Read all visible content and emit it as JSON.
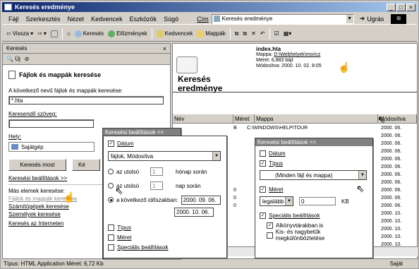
{
  "window": {
    "title": "Keresés eredménye",
    "controls": [
      "_",
      "□",
      "×"
    ]
  },
  "menubar": {
    "items": [
      "Fájl",
      "Szerkesztés",
      "Nézet",
      "Kedvencek",
      "Eszközök",
      "Súgó"
    ],
    "address_label": "Cím",
    "address_value": "Keresés eredménye",
    "go_label": "Ugrás"
  },
  "toolbar": {
    "back": "Vissza",
    "search": "Keresés",
    "history": "Előzmények",
    "favorites": "Kedvencek",
    "folders": "Mappák"
  },
  "left_pane": {
    "header": "Keresés",
    "new_label": "Új",
    "search_title": "Fájlok és mappák keresése",
    "name_label": "A következő nevű fájlok és mappák keresése:",
    "name_value": "*.hta",
    "text_label": "Keresendő szöveg:",
    "text_value": "",
    "place_label": "Hely:",
    "place_value": "Sajátgép",
    "search_now": "Keresés most",
    "stop_label": "Ké",
    "search_options_link": "Keresési beállítások >>",
    "other_label": "Más elemek keresése:",
    "links": [
      "Fájlok és mappák keresése",
      "Számítógépek keresése",
      "Személyek keresése",
      "Keresés az Interneten"
    ]
  },
  "banner": {
    "title": "Keresés eredménye",
    "file_name": "index.hta",
    "folder_label": "Mappa:",
    "folder_path": "D:\\Webhelyek\\moricz",
    "size_label": "Méret: 6,883 bájt",
    "modified_label": "Módosítva: 2000. 10. 02. 8:05"
  },
  "table": {
    "headers": [
      "Név",
      "Méret",
      "Mappa",
      "Módosítva"
    ],
    "rows": [
      {
        "name": "",
        "size": "B",
        "folder": "C:\\WINDOWS\\HELP\\TOUR",
        "modified": "2000. 06."
      },
      {
        "name": "",
        "size": "",
        "folder": "",
        "modified": "2000. 06."
      },
      {
        "name": "",
        "size": "",
        "folder": "",
        "modified": "2000. 06."
      },
      {
        "name": "",
        "size": "",
        "folder": "",
        "modified": "2000. 06."
      },
      {
        "name": "",
        "size": "",
        "folder": "",
        "modified": "2000. 06."
      },
      {
        "name": "",
        "size": "",
        "folder": "",
        "modified": "2000. 06."
      },
      {
        "name": "",
        "size": "",
        "folder": "",
        "modified": "2000. 06."
      },
      {
        "name": "",
        "size": "",
        "folder": "",
        "modified": "2000. 06."
      },
      {
        "name": "",
        "size": "0",
        "folder": "",
        "modified": "2000. 06."
      },
      {
        "name": "",
        "size": "0",
        "folder": "",
        "modified": "2000. 06."
      },
      {
        "name": "",
        "size": "0",
        "folder": "",
        "modified": "2000. 06."
      },
      {
        "name": "",
        "size": "",
        "folder": "",
        "modified": "2000. 10."
      },
      {
        "name": "",
        "size": "",
        "folder": "",
        "modified": "2000. 10."
      },
      {
        "name": "",
        "size": "",
        "folder": "",
        "modified": "2000. 10."
      },
      {
        "name": "",
        "size": "",
        "folder": "",
        "modified": "2000. 10."
      },
      {
        "name": "",
        "size": "",
        "folder": "",
        "modified": "2000. 10."
      }
    ]
  },
  "popup1": {
    "title": "Keresési beállítások <<",
    "date_label": "Dátum",
    "date_type": "fájlok, Módosítva",
    "last_label_1": "az utolsó",
    "last_value_1": "1",
    "last_unit_1": "hónap során",
    "last_label_2": "az utolsó",
    "last_value_2": "1",
    "last_unit_2": "nap során",
    "range_label": "a következő időszakban:",
    "date_from": "2000. 09. 06.",
    "date_to": "2000. 10. 06.",
    "type_label": "Típus",
    "size_label": "Méret",
    "advanced_label": "Speciális beállítások"
  },
  "popup2": {
    "title": "Keresési beállítások <<",
    "date_label": "Dátum",
    "type_label": "Típus",
    "type_value": "(Minden fájl és mappa)",
    "size_label": "Méret",
    "size_mode": "legalább",
    "size_value": "0",
    "size_unit": "KB",
    "advanced_label": "Speciális beállítások",
    "subfolders_label": "Alkönyvtárakban is",
    "case_label": "Kis- és nagybetűk megkülönböztetése"
  },
  "statusbar": {
    "left": "Típus: HTML Application Méret: 6,72 Kb",
    "right": "Saját"
  }
}
